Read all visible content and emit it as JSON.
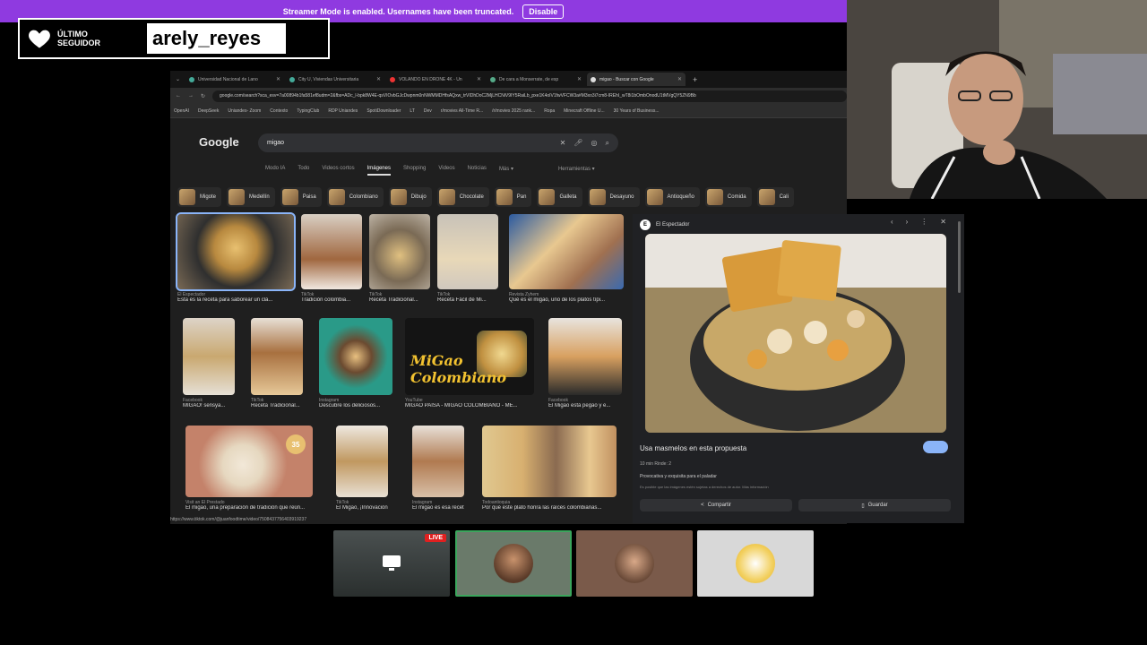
{
  "banner": {
    "text": "Streamer Mode is enabled. Usernames have been truncated.",
    "button": "Disable"
  },
  "follower": {
    "label_line1": "ÚLTIMO",
    "label_line2": "SEGUIDOR",
    "name": "arely_reyes"
  },
  "browser": {
    "tabs": [
      {
        "label": "Universidad Nacional de Lano",
        "active": false
      },
      {
        "label": "City U, Viviendas Universitaria",
        "active": false
      },
      {
        "label": "VOLANDO EN DRONE 4K - Un",
        "active": false
      },
      {
        "label": "De cara a Monserrate, de esp",
        "active": false
      },
      {
        "label": "migao - Buscar con Google",
        "active": true
      }
    ],
    "new_tab": "+",
    "url": "google.com/search?sca_esv=7a00894b1fa581ef8udm=2&fbs=ADc_l-bpk8W4E-qsVIOvbGJcDwpnm0nNWMMDHfsAQxw_trVIDhDoC2MjLHCNiV9IY5RaiLb_pxe1K4oIV1fwVFCW3a#M3xo3i7cm8-IREhI_wT8i1bOmbOnodU1tMVgQY5ZN9Bb",
    "bookmarks": [
      "OpenAI",
      "DeepSeek",
      "Uniandes- Zoom",
      "Contexto",
      "TypingClub",
      "RDP Uniandes",
      "SpotiDownloader",
      "LT",
      "Dev",
      "r/movies All-Time R...",
      "/r/movies 2025 rank...",
      "Ropa",
      "Minecraft Offline U...",
      "30 Years of Business..."
    ],
    "google": {
      "logo": "Google",
      "query": "migao",
      "tabs": [
        "Modo IA",
        "Todo",
        "Videos cortos",
        "Imágenes",
        "Shopping",
        "Videos",
        "Noticias",
        "Más ▾",
        "Herramientas ▾"
      ],
      "selected_tab": "Imágenes",
      "chips": [
        "Migote",
        "Medellín",
        "Paisa",
        "Colombiano",
        "Dibujo",
        "Chocolate",
        "Pan",
        "Galleta",
        "Desayuno",
        "Antioqueño",
        "Comida",
        "Cali"
      ],
      "results": [
        {
          "src": "El Espectador",
          "cap": "Esta es la receta para saborear un clá..."
        },
        {
          "src": "TikTok",
          "cap": "Tradición colombia..."
        },
        {
          "src": "TikTok",
          "cap": "Receta Tradicional..."
        },
        {
          "src": "TikTok",
          "cap": "Receta Fácil de Mi..."
        },
        {
          "src": "Revista Zyhem",
          "cap": "Qué es el migao, uno de los platos típi..."
        },
        {
          "src": "Facebook",
          "cap": "MIGAO! sensya..."
        },
        {
          "src": "TikTok",
          "cap": "Receta Tradicional..."
        },
        {
          "src": "Instagram",
          "cap": "Descubre los deliciosos..."
        },
        {
          "src": "YouTube",
          "cap": "MIGAO PAISA - MIGAO COLOMBIANO - ME..."
        },
        {
          "src": "Facebook",
          "cap": "El Migao está pegao y e..."
        },
        {
          "src": "Visit an El Prestado",
          "cap": "El migao, una preparación de tradición que reún..."
        },
        {
          "src": "TikTok",
          "cap": "El Migao, ¡Innovación..."
        },
        {
          "src": "Instagram",
          "cap": "El migao es esa recet..."
        },
        {
          "src": "Todoantioquia",
          "cap": "Por qué este plato honra las raíces colombianas..."
        }
      ],
      "migao_overlay": "MiGao Colombiano",
      "badge_35": "35"
    },
    "preview": {
      "source": "El Espectador",
      "title": "Usa masmelos en esta propuesta",
      "meta": "10 min   Rinde: 2",
      "desc": "Provocativa y exquisita para el paladar",
      "note": "Es posible que las imágenes estén sujetas a derechos de autor. Más información",
      "share": "Compartir",
      "save": "Guardar"
    },
    "status_url": "https://www.tiktok.com/@juanfoodtime/video/7508437756403919237"
  },
  "participants": {
    "live": "LIVE"
  },
  "colors": {
    "banner": "#8f3ae0",
    "accent": "#8ab4f8",
    "live": "#e02020"
  }
}
